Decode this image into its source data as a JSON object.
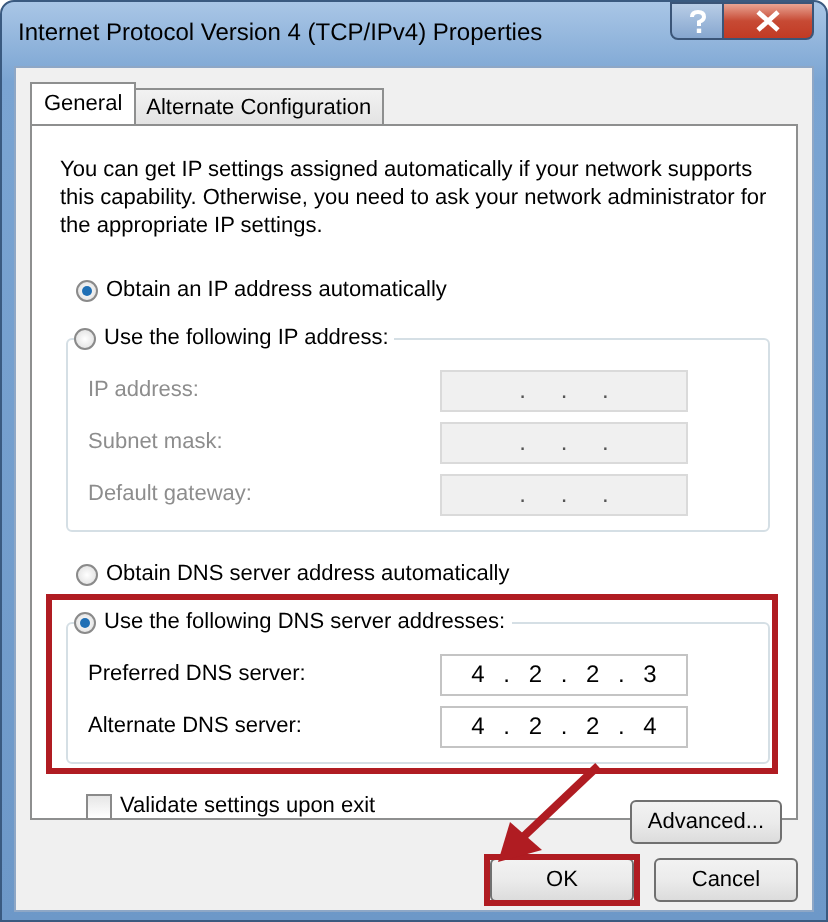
{
  "window": {
    "title": "Internet Protocol Version 4 (TCP/IPv4) Properties"
  },
  "tabs": [
    {
      "label": "General",
      "selected": true
    },
    {
      "label": "Alternate Configuration",
      "selected": false
    }
  ],
  "description": "You can get IP settings assigned automatically if your network supports this capability. Otherwise, you need to ask your network administrator for the appropriate IP settings.",
  "ip_section": {
    "auto_option": {
      "label": "Obtain an IP address automatically",
      "selected": true
    },
    "manual_option": {
      "label": "Use the following IP address:",
      "selected": false
    },
    "disabled": true,
    "fields": [
      {
        "label": "IP address:",
        "value": ". . ."
      },
      {
        "label": "Subnet mask:",
        "value": ". . ."
      },
      {
        "label": "Default gateway:",
        "value": ". . ."
      }
    ]
  },
  "dns_section": {
    "auto_option": {
      "label": "Obtain DNS server address automatically",
      "selected": false
    },
    "manual_option": {
      "label": "Use the following DNS server addresses:",
      "selected": true
    },
    "disabled": false,
    "fields": [
      {
        "label": "Preferred DNS server:",
        "value": "4 . 2 . 2 . 3"
      },
      {
        "label": "Alternate DNS server:",
        "value": "4 . 2 . 2 . 4"
      }
    ]
  },
  "validate_checkbox": {
    "label": "Validate settings upon exit",
    "checked": false
  },
  "buttons": {
    "advanced": "Advanced...",
    "ok": "OK",
    "cancel": "Cancel"
  }
}
